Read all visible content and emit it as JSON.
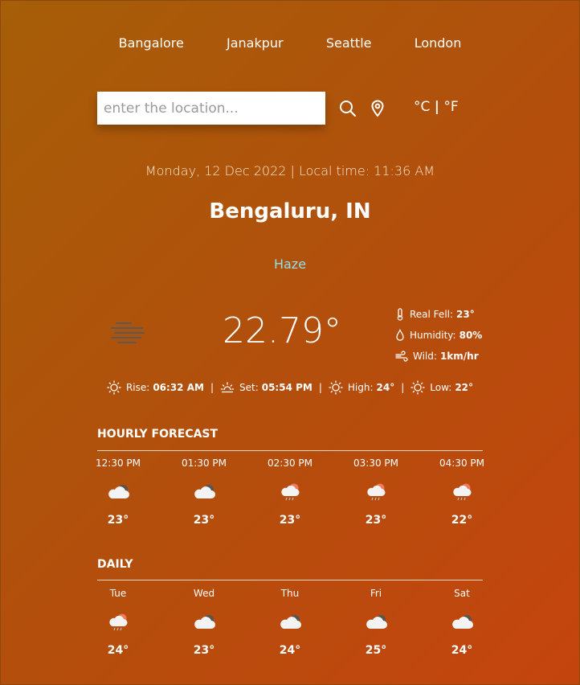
{
  "nav": {
    "cities": [
      "Bangalore",
      "Janakpur",
      "Seattle",
      "London"
    ]
  },
  "search": {
    "placeholder": "enter the location...",
    "value": "",
    "search_icon": "search-icon",
    "location_icon": "location-pin-icon"
  },
  "units": {
    "celsius": "°C",
    "separator": "|",
    "fahrenheit": "°F"
  },
  "current": {
    "datetime": "Monday, 12 Dec 2022 | Local time: 11:36 AM",
    "city": "Bengaluru, IN",
    "condition": "Haze",
    "condition_icon": "haze-icon",
    "temperature": "22.79°",
    "real_feel_label": "Real Fell:",
    "real_feel": "23°",
    "humidity_label": "Humidity:",
    "humidity": "80%",
    "wind_label": "Wild:",
    "wind": "1km/hr"
  },
  "sun": {
    "rise_label": "Rise:",
    "rise": "06:32 AM",
    "set_label": "Set:",
    "set": "05:54 PM",
    "high_label": "High:",
    "high": "24°",
    "low_label": "Low:",
    "low": "22°",
    "separator": "|"
  },
  "hourly": {
    "title": "HOURLY FORECAST",
    "items": [
      {
        "label": "12:30 PM",
        "temp": "23°",
        "icon": "cloudy-icon"
      },
      {
        "label": "01:30 PM",
        "temp": "23°",
        "icon": "cloudy-icon"
      },
      {
        "label": "02:30 PM",
        "temp": "23°",
        "icon": "rain-sun-icon"
      },
      {
        "label": "03:30 PM",
        "temp": "23°",
        "icon": "rain-sun-icon"
      },
      {
        "label": "04:30 PM",
        "temp": "22°",
        "icon": "rain-sun-icon"
      }
    ]
  },
  "daily": {
    "title": "DAILY",
    "items": [
      {
        "label": "Tue",
        "temp": "24°",
        "icon": "rain-sun-icon"
      },
      {
        "label": "Wed",
        "temp": "23°",
        "icon": "cloudy-icon"
      },
      {
        "label": "Thu",
        "temp": "24°",
        "icon": "cloudy-icon"
      },
      {
        "label": "Fri",
        "temp": "25°",
        "icon": "cloudy-icon"
      },
      {
        "label": "Sat",
        "temp": "24°",
        "icon": "cloudy-icon"
      }
    ]
  },
  "colors": {
    "condition_text": "#8fe1e6",
    "background_start": "#a65e08",
    "background_end": "#c5440e"
  }
}
